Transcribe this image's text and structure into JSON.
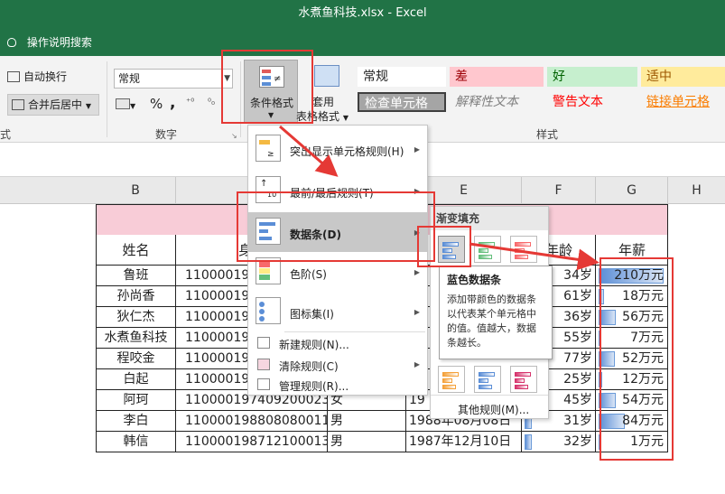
{
  "window": {
    "title": "水煮鱼科技.xlsx  -  Excel",
    "tell_me": "操作说明搜索"
  },
  "ribbon": {
    "wrap_text": "自动换行",
    "merge_center": "合并后居中",
    "left_group_label": "式",
    "number_format": "常规",
    "number_group_label": "数字",
    "percent": "%",
    "comma": ",",
    "cond_format": "条件格式",
    "table_format_line1": "套用",
    "table_format_line2": "表格格式",
    "styles_group_label": "样式",
    "styles": {
      "normal": "常规",
      "bad": "差",
      "good": "好",
      "neutral": "适中",
      "check_cell": "检查单元格",
      "explanatory": "解释性文本",
      "warning": "警告文本",
      "linked_cell": "链接单元格"
    }
  },
  "columns": [
    "B",
    "E",
    "F",
    "G",
    "H"
  ],
  "table": {
    "headers": [
      "姓名",
      "身份",
      "年龄",
      "年薪"
    ],
    "rows": [
      {
        "name": "鲁班",
        "id": "1100001980",
        "age": "34岁",
        "salary": "210万元",
        "pct": 1.0
      },
      {
        "name": "孙尚香",
        "id": "1100001950",
        "age": "61岁",
        "salary": "18万元",
        "pct": 0.08
      },
      {
        "name": "狄仁杰",
        "id": "1100001980",
        "age": "36岁",
        "salary": "56万元",
        "pct": 0.27
      },
      {
        "name": "水煮鱼科技",
        "id": "1100001960",
        "age": "55岁",
        "salary": "7万元",
        "pct": 0.03
      },
      {
        "name": "程咬金",
        "id": "1100001940",
        "age": "77岁",
        "salary": "52万元",
        "pct": 0.25
      },
      {
        "name": "白起",
        "id": "1100001990",
        "age": "25岁",
        "salary": "12万元",
        "pct": 0.06
      },
      {
        "name": "阿珂",
        "id": "110000197409200023",
        "gender": "女",
        "date": "19",
        "age": "45岁",
        "salary": "54万元",
        "pct": 0.26
      },
      {
        "name": "李白",
        "id": "110000198808080011",
        "gender": "男",
        "date": "1988年08月08日",
        "age": "31岁",
        "salary": "84万元",
        "pct": 0.4
      },
      {
        "name": "韩信",
        "id": "110000198712100013",
        "gender": "男",
        "date": "1987年12月10日",
        "age": "32岁",
        "salary": "1万元",
        "pct": 0.005
      }
    ]
  },
  "cf_menu": {
    "highlight_rules": "突出显示单元格规则(H)",
    "top_bottom": "最前/最后规则(T)",
    "data_bars": "数据条(D)",
    "color_scales": "色阶(S)",
    "icon_sets": "图标集(I)",
    "new_rule": "新建规则(N)...",
    "clear_rules": "清除规则(C)",
    "manage_rules": "管理规则(R)..."
  },
  "databar_menu": {
    "gradient_fill": "渐变填充",
    "more_rules": "其他规则(M)..."
  },
  "tooltip": {
    "title": "蓝色数据条",
    "body": "添加带颜色的数据条以代表某个单元格中的值。值越大，数据条越长。"
  },
  "colors": {
    "excel_green": "#217346",
    "annotation_red": "#e53935",
    "bar_blue": "#5b8ed6"
  }
}
